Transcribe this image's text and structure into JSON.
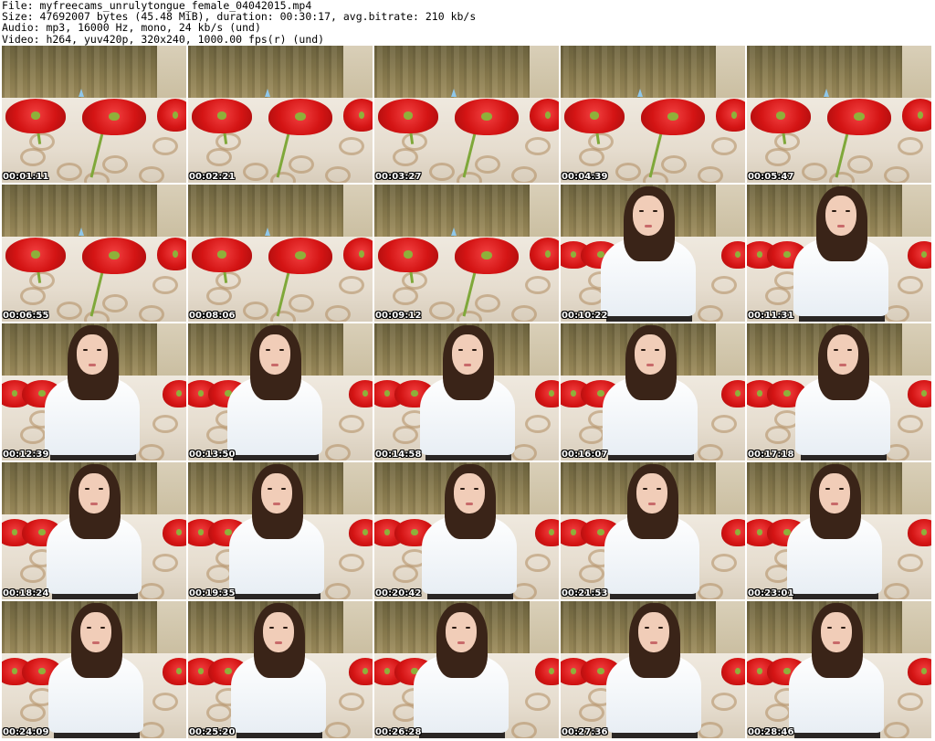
{
  "header": {
    "file_line": "File: myfreecams_unrulytongue_female_04042015.mp4",
    "size_line": "Size: 47692007 bytes (45.48 MiB), duration: 00:30:17, avg.bitrate: 210 kb/s",
    "audio_line": "Audio: mp3, 16000 Hz, mono, 24 kb/s (und)",
    "video_line": "Video: h264, yuv420p, 320x240, 1000.00 fps(r) (und)"
  },
  "thumbnails": [
    {
      "time": "00:01:11",
      "scene": "empty"
    },
    {
      "time": "00:02:21",
      "scene": "empty"
    },
    {
      "time": "00:03:27",
      "scene": "empty"
    },
    {
      "time": "00:04:39",
      "scene": "empty"
    },
    {
      "time": "00:05:47",
      "scene": "empty"
    },
    {
      "time": "00:06:55",
      "scene": "empty"
    },
    {
      "time": "00:08:06",
      "scene": "empty"
    },
    {
      "time": "00:09:12",
      "scene": "empty"
    },
    {
      "time": "00:10:22",
      "scene": "person"
    },
    {
      "time": "00:11:31",
      "scene": "person"
    },
    {
      "time": "00:12:39",
      "scene": "person"
    },
    {
      "time": "00:13:50",
      "scene": "person"
    },
    {
      "time": "00:14:58",
      "scene": "person"
    },
    {
      "time": "00:16:07",
      "scene": "person"
    },
    {
      "time": "00:17:18",
      "scene": "person"
    },
    {
      "time": "00:18:24",
      "scene": "person"
    },
    {
      "time": "00:19:35",
      "scene": "person"
    },
    {
      "time": "00:20:42",
      "scene": "person"
    },
    {
      "time": "00:21:53",
      "scene": "person"
    },
    {
      "time": "00:23:01",
      "scene": "person"
    },
    {
      "time": "00:24:09",
      "scene": "person"
    },
    {
      "time": "00:25:20",
      "scene": "person"
    },
    {
      "time": "00:26:28",
      "scene": "person"
    },
    {
      "time": "00:27:36",
      "scene": "person"
    },
    {
      "time": "00:28:46",
      "scene": "person"
    }
  ]
}
